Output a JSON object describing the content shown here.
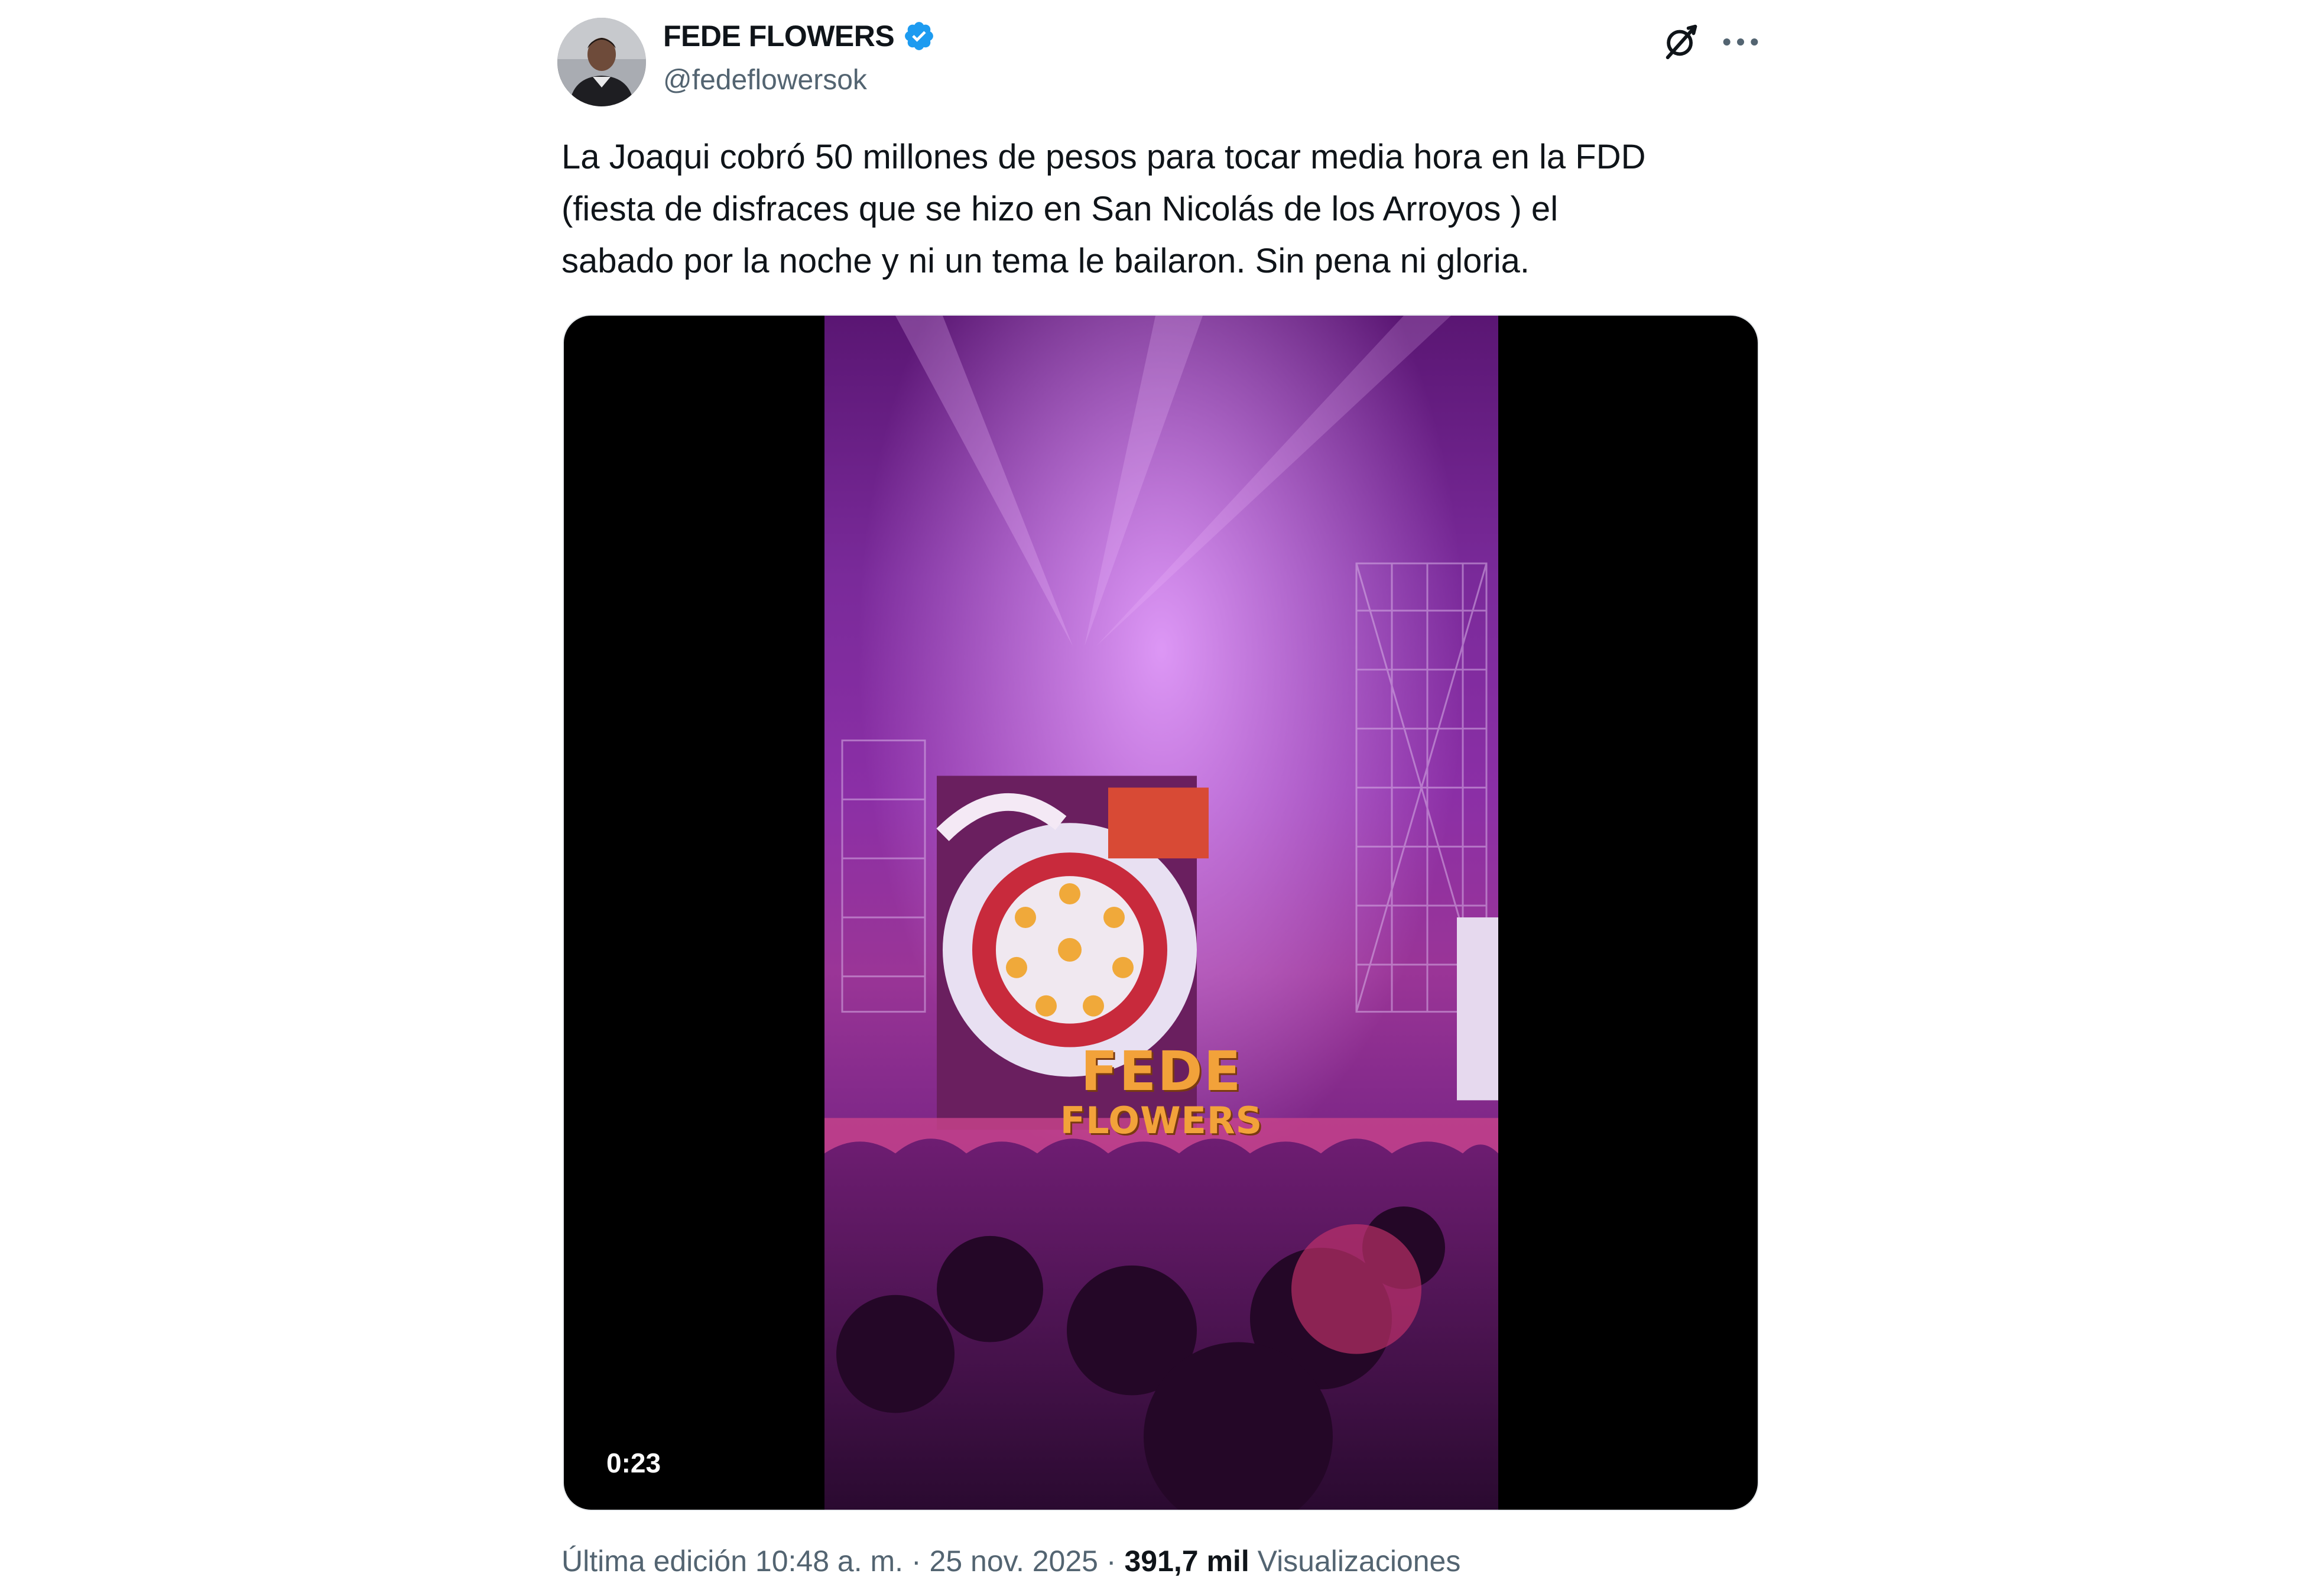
{
  "author": {
    "display_name": "FEDE FLOWERS",
    "handle": "@fedeflowersok",
    "verified": true,
    "verified_color": "#1d9bf0"
  },
  "header_icons": {
    "grok": "grok-icon",
    "more": "more-options-icon"
  },
  "tweet": {
    "text": "La Joaqui cobró 50 millones de pesos para tocar media hora en la FDD\n(fiesta de disfraces  que se hizo en San Nicolás de los Arroyos ) el\nsabado por la noche y ni un tema le bailaron. Sin pena ni gloria."
  },
  "media": {
    "type": "video",
    "duration": "0:23",
    "watermark_line1": "FEDE",
    "watermark_line2": "FLOWERS"
  },
  "meta": {
    "edited_label": "Última edición",
    "time": "10:48 a. m.",
    "separator": "·",
    "date": "25 nov. 2025",
    "views_count": "391,7 mil",
    "views_label": "Visualizaciones"
  },
  "colors": {
    "text_primary": "#0f1419",
    "text_secondary": "#536471",
    "accent": "#1d9bf0"
  }
}
